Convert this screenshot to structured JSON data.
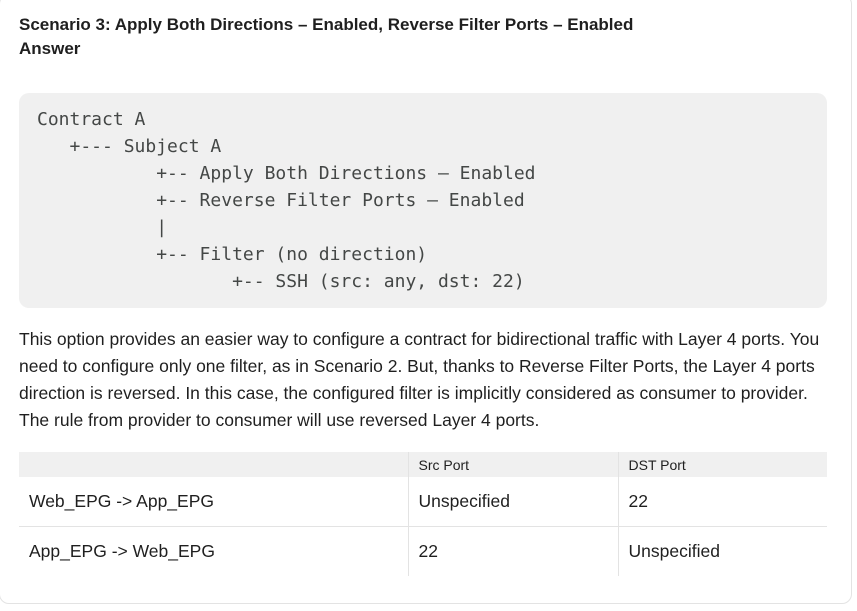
{
  "heading": {
    "line1": "Scenario 3: Apply Both Directions – Enabled, Reverse Filter Ports – Enabled",
    "line2": "Answer"
  },
  "code": {
    "lines": [
      "Contract A",
      "   +--- Subject A",
      "           +-- Apply Both Directions — Enabled",
      "           +-- Reverse Filter Ports — Enabled",
      "           |",
      "           +-- Filter (no direction)",
      "                  +-- SSH (src: any, dst: 22)"
    ]
  },
  "paragraph": "This option provides an easier way to configure a contract for bidirectional traffic with Layer 4 ports. You need to configure only one filter, as in Scenario 2. But, thanks to Reverse Filter Ports, the Layer 4 ports direction is reversed. In this case, the configured filter is implicitly considered as consumer to provider. The rule from provider to consumer will use reversed Layer 4 ports.",
  "table": {
    "headers": [
      "",
      "Src Port",
      "DST Port"
    ],
    "rows": [
      [
        "Web_EPG -> App_EPG",
        "Unspecified",
        "22"
      ],
      [
        "App_EPG -> Web_EPG",
        "22",
        "Unspecified"
      ]
    ]
  }
}
